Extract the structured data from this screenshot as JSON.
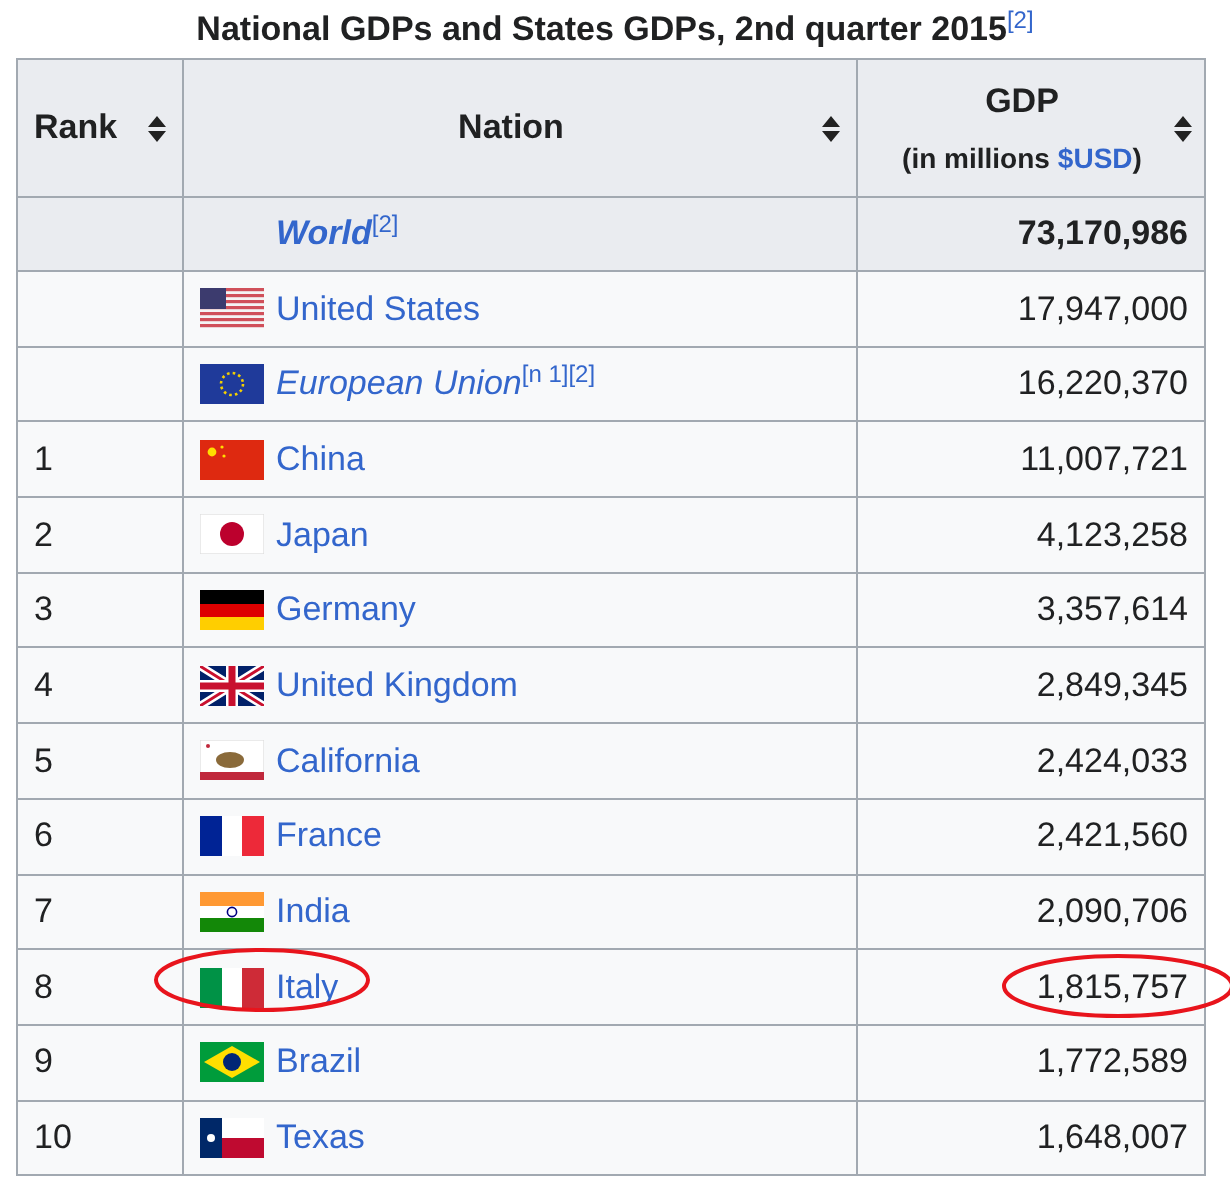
{
  "title": "National GDPs and States GDPs, 2nd quarter 2015$^{[2]}$",
  "columns": {
    "rank": "Rank",
    "nation": "Nation",
    "gdp": "GDP",
    "gdp_sub_prefix": "(in millions",
    "gdp_sub_link": "$USD",
    "gdp_sub_suffix": ")"
  },
  "rows": [
    {
      "kind": "total",
      "nation": "World$^{[2]}$",
      "gdp": "73,170,986",
      "italic": true,
      "circled": false
    },
    {
      "kind": "entry",
      "nation": "United States",
      "gdp": "17,947,000",
      "italic": false,
      "circled": false
    },
    {
      "kind": "entry",
      "nation": "European Union$^{[n 1][2]}$",
      "gdp": "16,220,370",
      "italic": true,
      "circled": false
    },
    {
      "kind": "entry",
      "rank": "1",
      "nation": "China",
      "gdp": "11,007,721",
      "italic": false,
      "circled": false
    },
    {
      "kind": "entry",
      "rank": "2",
      "nation": "Japan",
      "gdp": "4,123,258",
      "italic": false,
      "circled": false
    },
    {
      "kind": "entry",
      "rank": "3",
      "nation": "Germany",
      "gdp": "3,357,614",
      "italic": false,
      "circled": false
    },
    {
      "kind": "entry",
      "rank": "4",
      "nation": "United Kingdom",
      "gdp": "2,849,345",
      "italic": false,
      "circled": false
    },
    {
      "kind": "entry",
      "rank": "5",
      "nation": "California",
      "gdp": "2,424,033",
      "italic": false,
      "circled": false
    },
    {
      "kind": "entry",
      "rank": "6",
      "nation": "France",
      "gdp": "2,421,560",
      "italic": false,
      "circled": false
    },
    {
      "kind": "entry",
      "rank": "7",
      "nation": "India",
      "gdp": "2,090,706",
      "italic": false,
      "circled": false
    },
    {
      "kind": "entry",
      "rank": "8",
      "nation": "Italy",
      "gdp": "1,815,757",
      "italic": false,
      "circled": true
    },
    {
      "kind": "entry",
      "rank": "9",
      "nation": "Brazil",
      "gdp": "1,772,589",
      "italic": false,
      "circled": false
    },
    {
      "kind": "entry",
      "rank": "10",
      "nation": "Texas",
      "gdp": "1,648,007",
      "italic": false,
      "circled": false
    }
  ]
}
